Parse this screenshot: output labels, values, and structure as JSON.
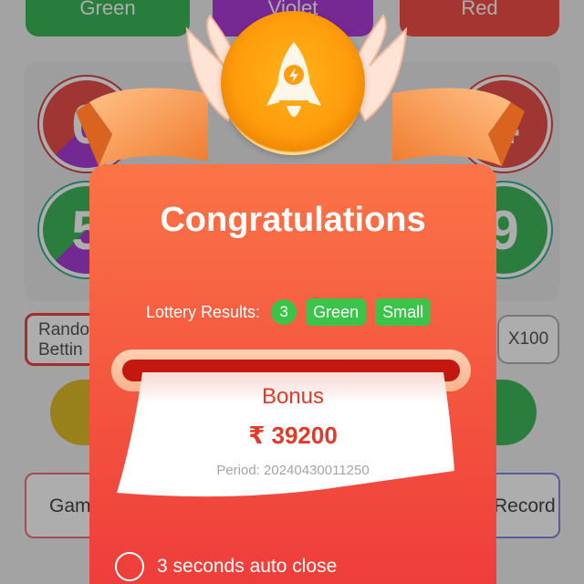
{
  "color_buttons": {
    "green": "Green",
    "violet": "Violet",
    "red": "Red"
  },
  "balls": {
    "b0": "0",
    "b4": "4",
    "b5": "5",
    "b9": "9"
  },
  "random_button": {
    "line1": "Rando",
    "line2": "Bettin"
  },
  "multiplier": "X100",
  "tabs": {
    "game": "Gam",
    "record": "Record"
  },
  "popup": {
    "title": "Congratulations",
    "lottery_label": "Lottery Results:",
    "result_number": "3",
    "result_color": "Green",
    "result_size": "Small",
    "bonus_label": "Bonus",
    "bonus_amount": "₹ 39200",
    "period": "Period: 20240430011250",
    "auto_close": "3 seconds auto close"
  },
  "colors": {
    "accent": "#f3543f",
    "result_chip": "#3cc34a",
    "bonus_text": "#e03b2a",
    "medal": "#ff9c0c"
  },
  "icons": [
    "rocket-icon",
    "radio-unchecked-icon"
  ]
}
